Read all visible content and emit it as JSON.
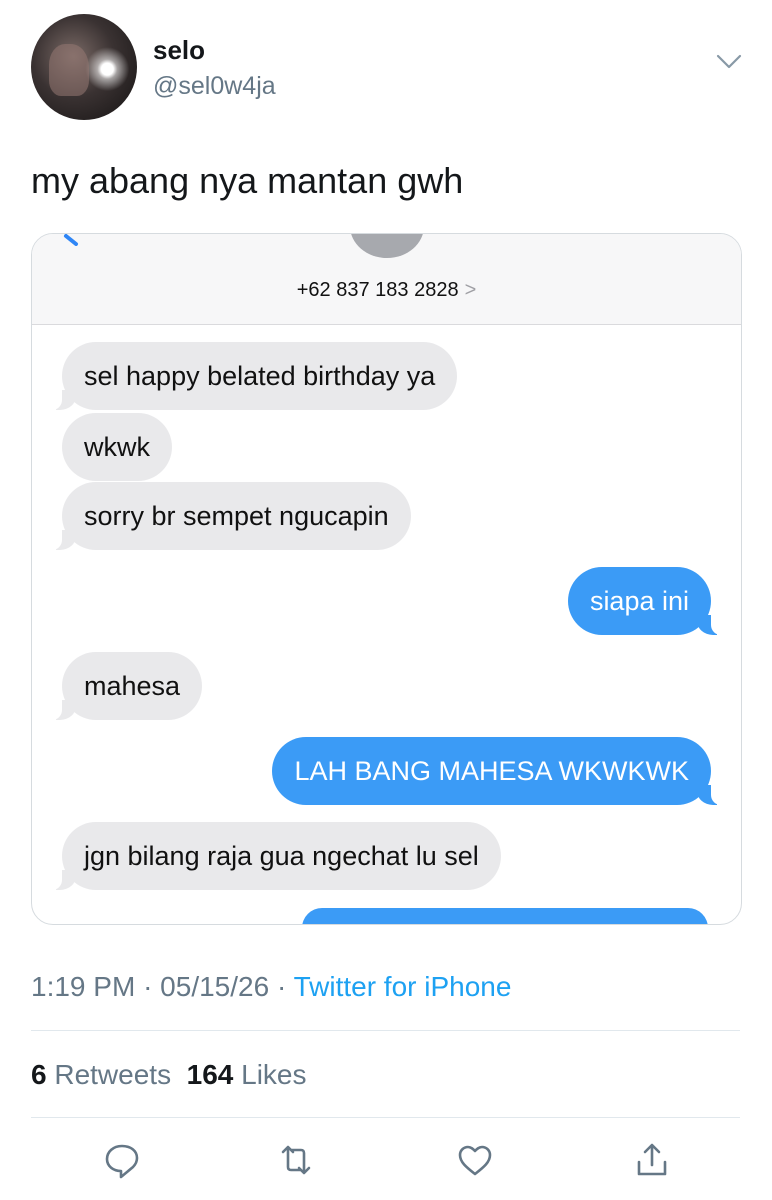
{
  "tweet": {
    "display_name": "selo",
    "handle": "@sel0w4ja",
    "text": "my abang nya mantan gwh",
    "time": "1:19 PM",
    "date": "05/15/26",
    "separator": "·",
    "source": "Twitter for iPhone",
    "retweets_count": "6",
    "retweets_label": "Retweets",
    "likes_count": "164",
    "likes_label": "Likes"
  },
  "screenshot": {
    "contact": "+62 837 183 2828",
    "contact_arrow": ">",
    "messages": [
      {
        "side": "received",
        "text": "sel happy belated birthday ya"
      },
      {
        "side": "received",
        "text": "wkwk"
      },
      {
        "side": "received",
        "text": "sorry br sempet ngucapin"
      },
      {
        "side": "sent",
        "text": "siapa ini"
      },
      {
        "side": "received",
        "text": "mahesa"
      },
      {
        "side": "sent",
        "text": "LAH BANG MAHESA WKWKWK"
      },
      {
        "side": "received",
        "text": "jgn bilang raja gua ngechat lu sel"
      }
    ]
  },
  "icons": {
    "more": "chevron-down-icon",
    "reply": "reply-icon",
    "retweet": "retweet-icon",
    "like": "heart-icon",
    "share": "share-icon"
  },
  "colors": {
    "link_blue": "#1da1f2",
    "sent_bubble": "#3b9bf6",
    "received_bubble": "#e9e9eb",
    "secondary_text": "#657786"
  }
}
